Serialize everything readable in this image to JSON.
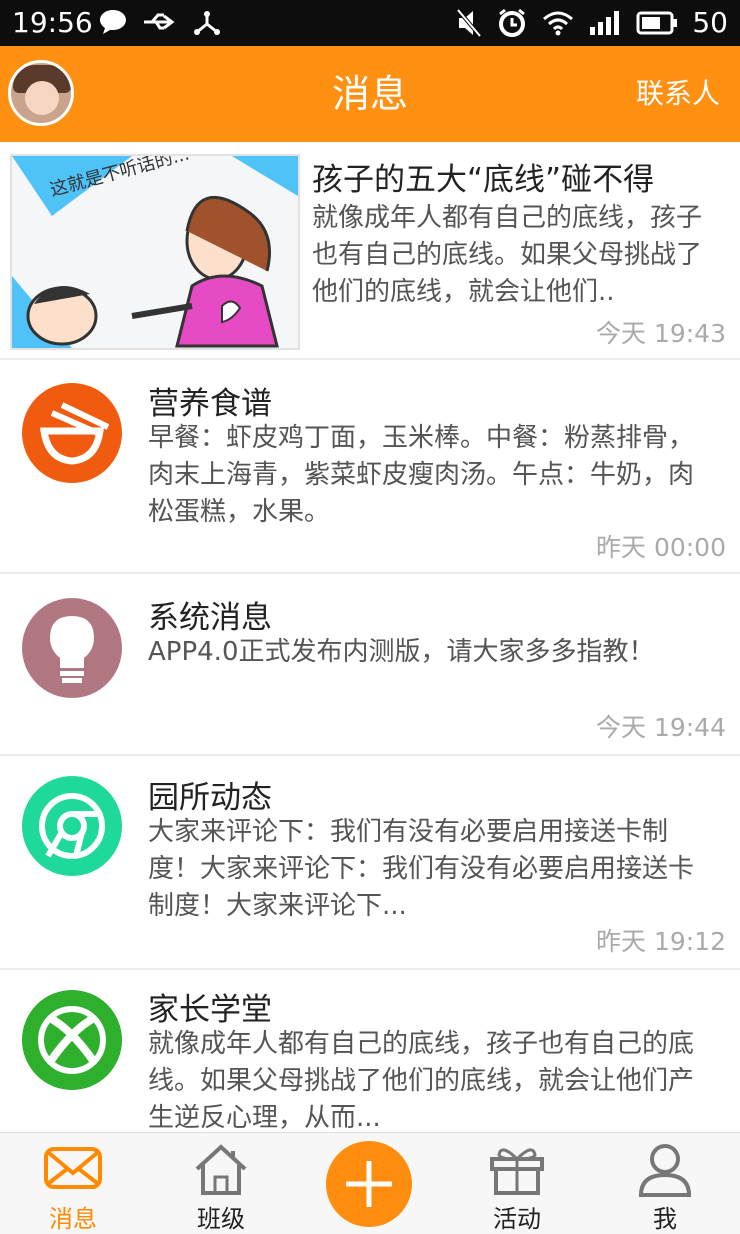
{
  "status_bar": {
    "time": "19:56",
    "battery": "50",
    "left_icons": [
      "chat-bubble-icon",
      "usb-icon",
      "share-node-icon"
    ],
    "right_icons": [
      "mute-icon",
      "alarm-icon",
      "wifi-icon",
      "signal-icon",
      "battery-icon"
    ]
  },
  "header": {
    "title": "消息",
    "contacts_label": "联系人",
    "bg_color": "#ff9011"
  },
  "messages": [
    {
      "title": "孩子的五大“底线”碰不得",
      "desc": "就像成年人都有自己的底线，孩子也有自己的底线。如果父母挑战了他们的底线，就会让他们..",
      "time": "今天 19:43",
      "thumb_caption": "这就是不听话的..."
    },
    {
      "title": "营养食谱",
      "desc": "早餐：虾皮鸡丁面，玉米棒。中餐：粉蒸排骨，肉末上海青，紫菜虾皮瘦肉汤。午点：牛奶，肉松蛋糕，水果。",
      "time": "昨天 00:00",
      "icon": "bowl-chopsticks-icon",
      "color": "#f05b10"
    },
    {
      "title": "系统消息",
      "desc": "APP4.0正式发布内测版，请大家多多指教！",
      "time": "今天 19:44",
      "icon": "lightbulb-icon",
      "color": "#b07780"
    },
    {
      "title": "园所动态",
      "desc": "大家来评论下：我们有没有必要启用接送卡制度！大家来评论下：我们有没有必要启用接送卡制度！大家来评论下...",
      "time": "昨天 19:12",
      "icon": "chrome-icon",
      "color": "#1ed99a"
    },
    {
      "title": "家长学堂",
      "desc": "就像成年人都有自己的底线，孩子也有自己的底线。如果父母挑战了他们的底线，就会让他们产生逆反心理，从而...",
      "time": "",
      "icon": "xbox-icon",
      "color": "#2fb02d"
    }
  ],
  "tabs": [
    {
      "label": "消息",
      "icon": "envelope-icon",
      "active": true
    },
    {
      "label": "班级",
      "icon": "home-icon",
      "active": false
    },
    {
      "label": "",
      "icon": "plus-icon",
      "active": false
    },
    {
      "label": "活动",
      "icon": "gift-icon",
      "active": false
    },
    {
      "label": "我",
      "icon": "person-icon",
      "active": false
    }
  ]
}
